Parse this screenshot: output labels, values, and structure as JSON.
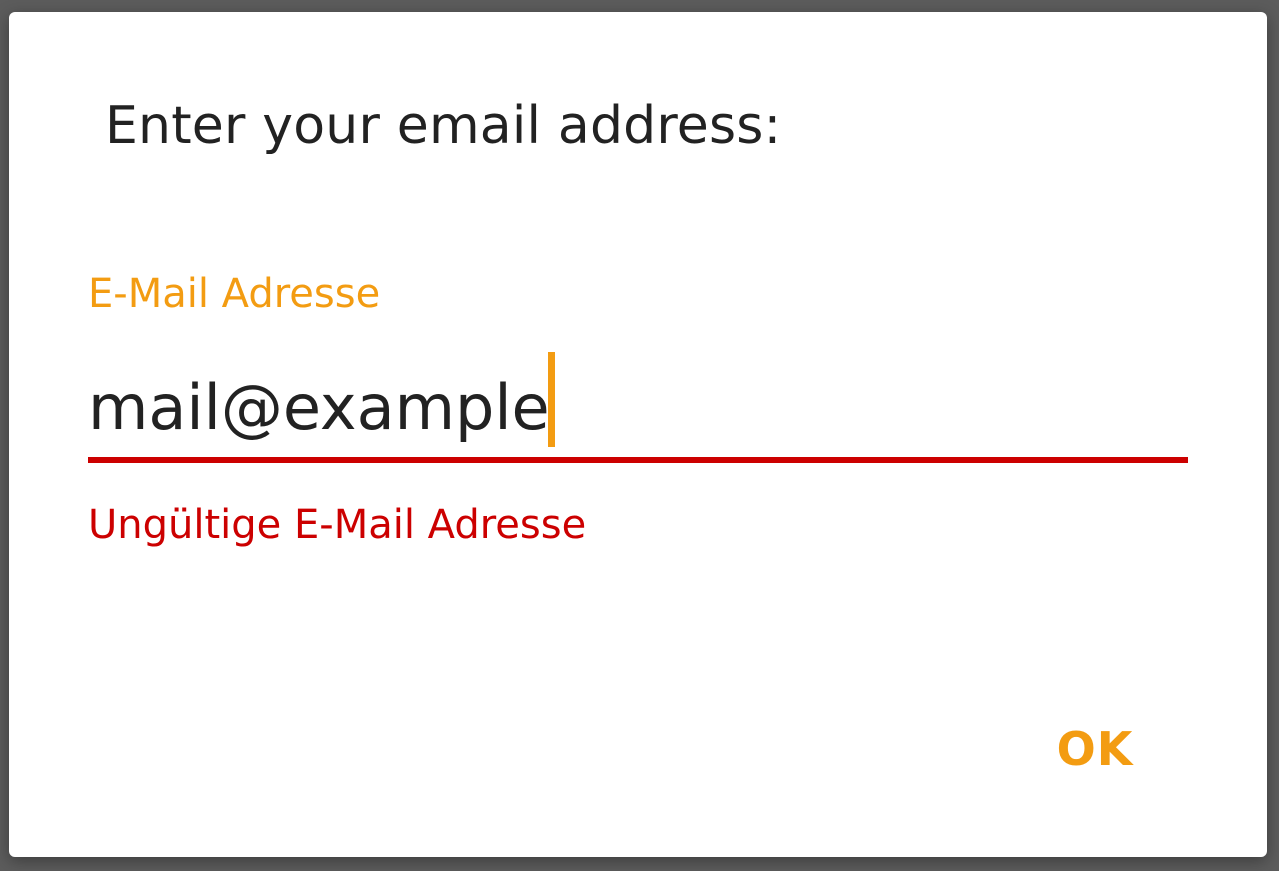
{
  "dialog": {
    "title": "Enter your email address:",
    "field": {
      "label": "E-Mail Adresse",
      "value": "mail@example",
      "error": "Ungültige E-Mail Adresse"
    },
    "ok_label": "OK"
  },
  "colors": {
    "accent": "#f39c12",
    "error": "#cc0000",
    "text": "#222222",
    "dialog_background": "#ffffff",
    "backdrop": "#5c5c5c"
  }
}
